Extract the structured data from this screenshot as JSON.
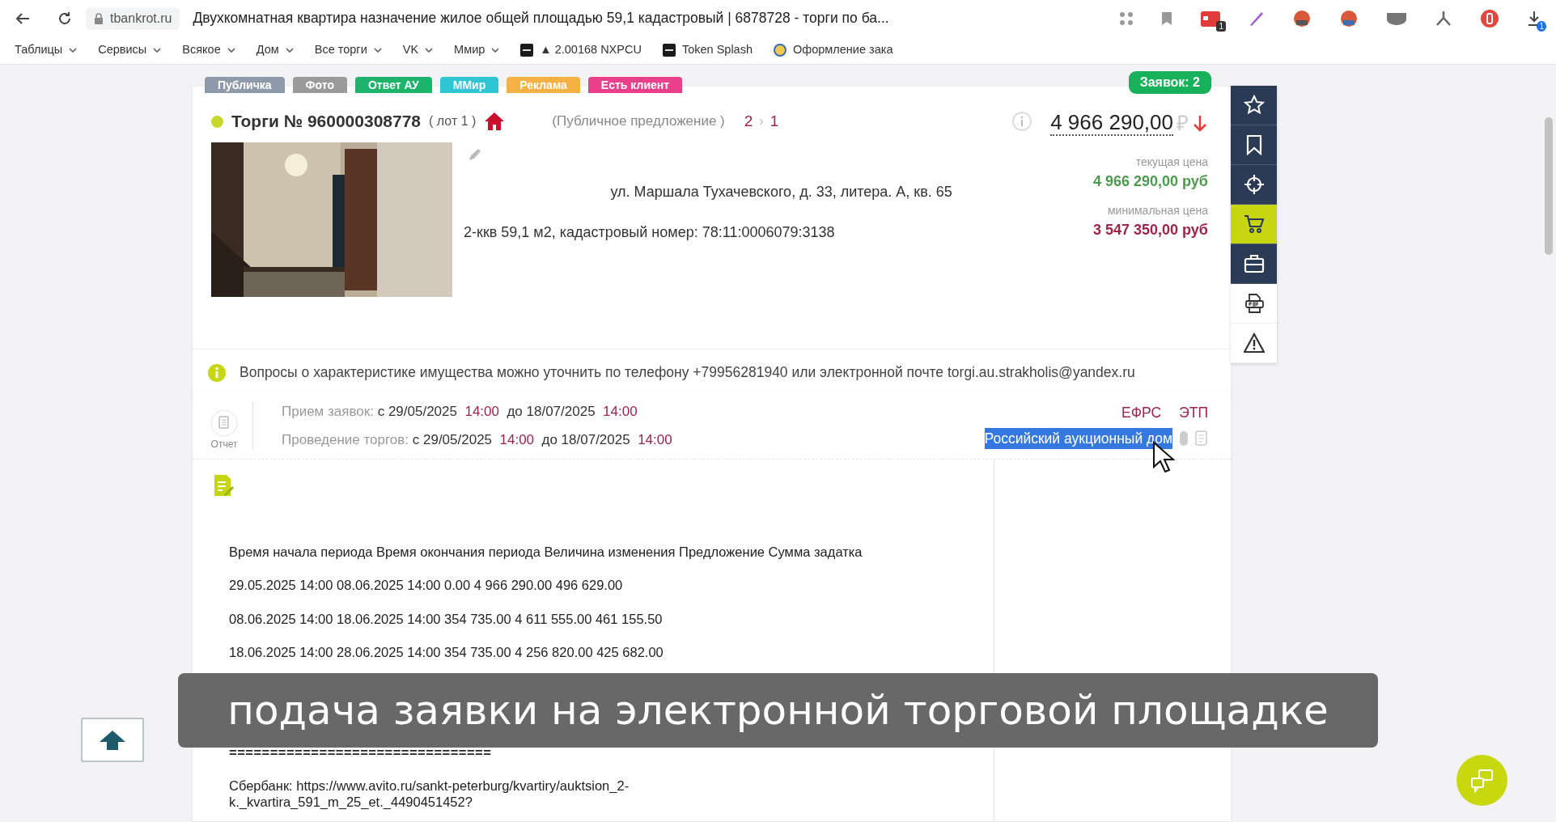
{
  "browser": {
    "url": "tbankrot.ru",
    "title": "Двухкомнатная квартира назначение жилое общей площадью 59,1 кадастровый | 6878728 - торги по ба...",
    "extension_badges": [
      "1"
    ],
    "download_badge": "1",
    "bookmarks": [
      {
        "label": "Таблицы",
        "kind": "folder"
      },
      {
        "label": "Сервисы",
        "kind": "folder"
      },
      {
        "label": "Всякое",
        "kind": "folder"
      },
      {
        "label": "Дом",
        "kind": "folder"
      },
      {
        "label": "Все торги",
        "kind": "folder"
      },
      {
        "label": "VK",
        "kind": "folder"
      },
      {
        "label": "Ммир",
        "kind": "folder"
      },
      {
        "label": "▲ 2.00168 NXPCU",
        "kind": "site"
      },
      {
        "label": "Token Splash",
        "kind": "site"
      },
      {
        "label": "Оформление зака",
        "kind": "globe"
      }
    ]
  },
  "tags": [
    {
      "label": "Публичка",
      "color": "#8e9aaa"
    },
    {
      "label": "Фото",
      "color": "#9a9a9a"
    },
    {
      "label": "Ответ АУ",
      "color": "#1db36b"
    },
    {
      "label": "ММир",
      "color": "#2ec5d6"
    },
    {
      "label": "Реклама",
      "color": "#f6b143"
    },
    {
      "label": "Есть клиент",
      "color": "#ea3f8b"
    }
  ],
  "applications": {
    "label": "Заявок:",
    "count": "2"
  },
  "lot": {
    "status": {
      "color": "#c8d82a"
    },
    "title": "Торги № 960000308778",
    "lot": "( лот 1 )",
    "type": "(Публичное предложение )",
    "stage_from": "2",
    "stage_sep": "›",
    "stage_to": "1",
    "price": "4 966 290,00",
    "currency": "₽",
    "price_falling": true,
    "current_label": "текущая цена",
    "current_price": "4 966 290,00 руб",
    "min_label": "минимальная цена",
    "min_price": "3 547 350,00 руб",
    "address": "ул. Маршала Тухачевского, д. 33, литера. А, кв. 65",
    "description": "2-ккв 59,1 м2, кадастровый номер: 78:11:0006079:3138"
  },
  "info": "Вопросы о характеристике имущества можно уточнить по телефону +79956281940 или электронной почте torgi.au.strakholis@yandex.ru",
  "toolbar": [
    {
      "kind": "star",
      "selected": false
    },
    {
      "kind": "bookmark",
      "selected": false
    },
    {
      "kind": "target",
      "selected": false
    },
    {
      "kind": "cart",
      "selected": true
    },
    {
      "kind": "briefcase",
      "selected": false
    },
    {
      "kind": "pdf",
      "selected": false
    },
    {
      "kind": "warning",
      "selected": false
    }
  ],
  "schedule": {
    "report_label": "Отчет",
    "rows": [
      {
        "label": "Прием заявок:",
        "from": "с 29/05/2025",
        "from_time": "14:00",
        "to": "до 18/07/2025",
        "to_time": "14:00"
      },
      {
        "label": "Проведение торгов:",
        "from": "с 29/05/2025",
        "from_time": "14:00",
        "to": "до 18/07/2025",
        "to_time": "14:00"
      }
    ],
    "links": [
      "ЕФРС",
      "ЭТП"
    ],
    "organizer": {
      "label": "Российский аукционный дом",
      "selected": true
    }
  },
  "body_lines": [
    "Время начала периода Время окончания периода Величина изменения Предложение Сумма задатка",
    "29.05.2025 14:00 08.06.2025 14:00 0.00 4 966 290.00 496 629.00",
    "08.06.2025 14:00 18.06.2025 14:00 354 735.00 4 611 555.00 461 155.50",
    "18.06.2025 14:00 28.06.2025 14:00 354 735.00 4 256 820.00 425 682.00",
    "================================",
    "Сбербанк: https://www.avito.ru/sankt-peterburg/kvartiry/auktsion_2-k._kvartira_591_m_25_et._4490451452?"
  ],
  "caption": "подача заявки на электронной торговой площадке"
}
